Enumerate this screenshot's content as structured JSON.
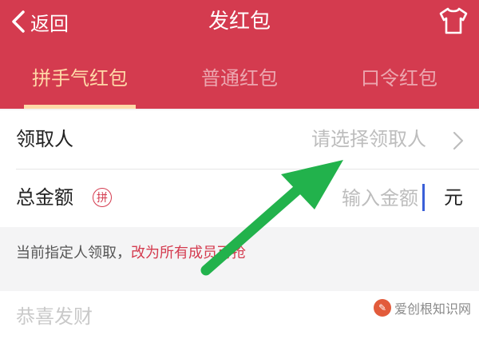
{
  "header": {
    "back_label": "返回",
    "title": "发红包",
    "shirt_icon": "shirt-icon"
  },
  "tabs": [
    {
      "label": "拼手气红包",
      "active": true
    },
    {
      "label": "普通红包",
      "active": false
    },
    {
      "label": "口令红包",
      "active": false
    }
  ],
  "form": {
    "recipient": {
      "label": "领取人",
      "placeholder": "请选择领取人"
    },
    "amount": {
      "label": "总金额",
      "badge": "拼",
      "placeholder": "输入金额",
      "unit": "元"
    }
  },
  "hint": {
    "text": "当前指定人领取，",
    "link": "改为所有成员可抢"
  },
  "message": {
    "placeholder": "恭喜发财"
  },
  "watermark": {
    "text": "爱创根知识网"
  },
  "colors": {
    "brand_red": "#d43b4f",
    "active_tab": "#ffd9a8",
    "arrow_green": "#22b24c"
  }
}
